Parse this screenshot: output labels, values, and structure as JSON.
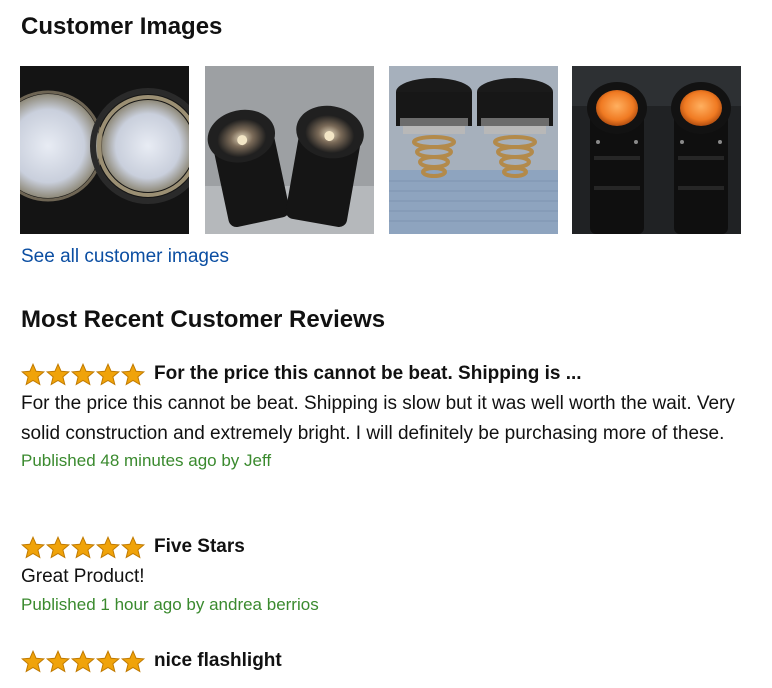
{
  "customer_images": {
    "heading": "Customer Images",
    "thumbnails": [
      {
        "icon": "flashlight-beams-photo"
      },
      {
        "icon": "flashlight-heads-photo"
      },
      {
        "icon": "flashlight-springs-photo"
      },
      {
        "icon": "flashlight-orange-lens-photo"
      }
    ],
    "see_all_link": "See all customer images"
  },
  "reviews_section": {
    "heading": "Most Recent Customer Reviews",
    "star_color": "#f0a30a",
    "meta_color": "#3a8a2e",
    "reviews": [
      {
        "rating": 5,
        "title": "For the price this cannot be beat. Shipping is ...",
        "body": "For the price this cannot be beat. Shipping is slow but it was well worth the wait. Very solid construction and extremely bright. I will definitely be purchasing more of these.",
        "meta": "Published 48 minutes ago by Jeff"
      },
      {
        "rating": 5,
        "title": "Five Stars",
        "body": "Great Product!",
        "meta": "Published 1 hour ago by andrea berrios"
      },
      {
        "rating": 5,
        "title": "nice flashlight"
      }
    ]
  }
}
